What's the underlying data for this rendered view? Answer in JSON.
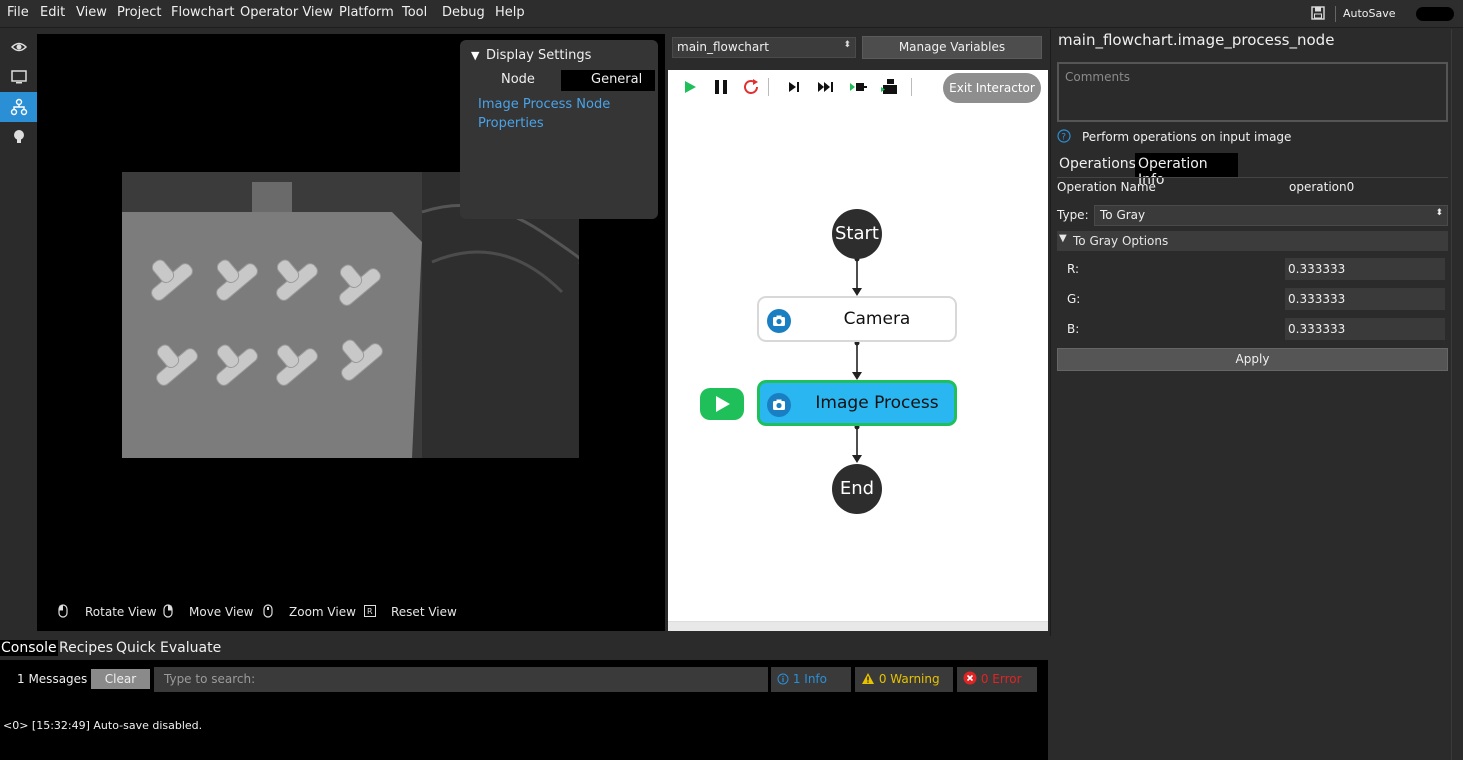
{
  "menu": [
    "File",
    "Edit",
    "View",
    "Project",
    "Flowchart",
    "Operator View",
    "Platform",
    "Tool",
    "Debug",
    "Help"
  ],
  "autosave_label": "AutoSave",
  "display_settings": {
    "title": "Display Settings",
    "tabs": [
      "Node",
      "General"
    ],
    "link_line1": "Image Process Node",
    "link_line2": "Properties"
  },
  "view_hints": [
    "Rotate View",
    "Move View",
    "Zoom View",
    "Reset View"
  ],
  "flowchart": {
    "selected_flow": "main_flowchart",
    "manage_variables": "Manage Variables",
    "exit_interactor": "Exit Interactor",
    "nodes": {
      "start": "Start",
      "camera": "Camera",
      "image_process": "Image Process",
      "end": "End"
    }
  },
  "panel": {
    "title": "main_flowchart.image_process_node",
    "comments_placeholder": "Comments",
    "description": "Perform operations on input image",
    "tabs": [
      "Operations",
      "Operation Info"
    ],
    "operation_name_label": "Operation Name",
    "operation_name_value": "operation0",
    "type_label": "Type:",
    "type_value": "To Gray",
    "options_header": "To Gray Options",
    "r_label": "R:",
    "r_value": "0.333333",
    "g_label": "G:",
    "g_value": "0.333333",
    "b_label": "B:",
    "b_value": "0.333333",
    "apply": "Apply"
  },
  "console": {
    "tabs": [
      "Console",
      "Recipes",
      "Quick Evaluate"
    ],
    "messages_count": "1 Messages",
    "clear": "Clear",
    "search_placeholder": "Type to search:",
    "info": "1 Info",
    "warning": "0 Warning",
    "error": "0 Error",
    "log": "<0> [15:32:49] Auto-save disabled."
  },
  "colors": {
    "accent": "#2b8fd6",
    "node_selected_fill": "#2ab6f1",
    "node_selected_border": "#1fbf5a",
    "link": "#4aa3e8",
    "warning": "#e6c200",
    "error": "#e02424"
  }
}
